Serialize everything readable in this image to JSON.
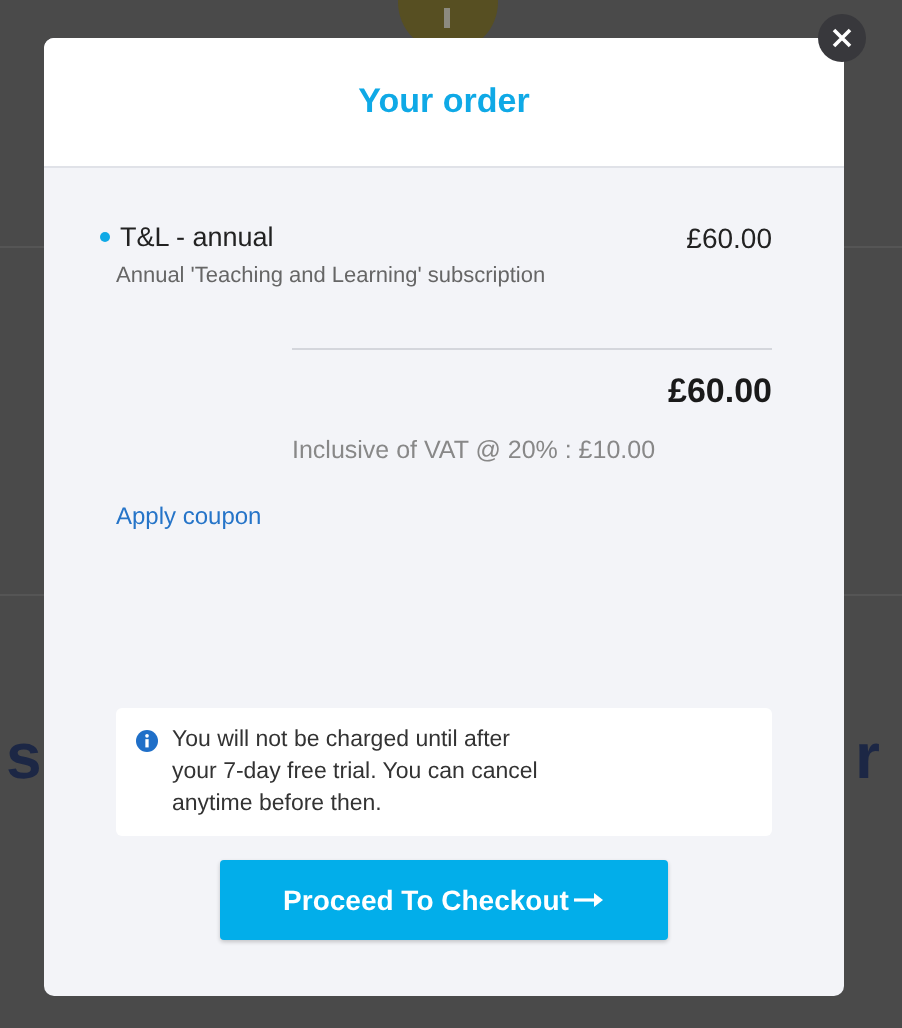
{
  "background": {
    "left_fragment": "s",
    "right_fragment": "r"
  },
  "modal": {
    "title": "Your order",
    "items": [
      {
        "name": "T&L - annual",
        "description": "Annual 'Teaching and Learning' subscription",
        "price": "£60.00"
      }
    ],
    "total": "£60.00",
    "vat_note": "Inclusive of VAT @ 20% : £10.00",
    "coupon_link": "Apply coupon",
    "info": "You will not be charged until after your 7-day free trial. You can cancel anytime before then.",
    "checkout_button": "Proceed To Checkout"
  }
}
